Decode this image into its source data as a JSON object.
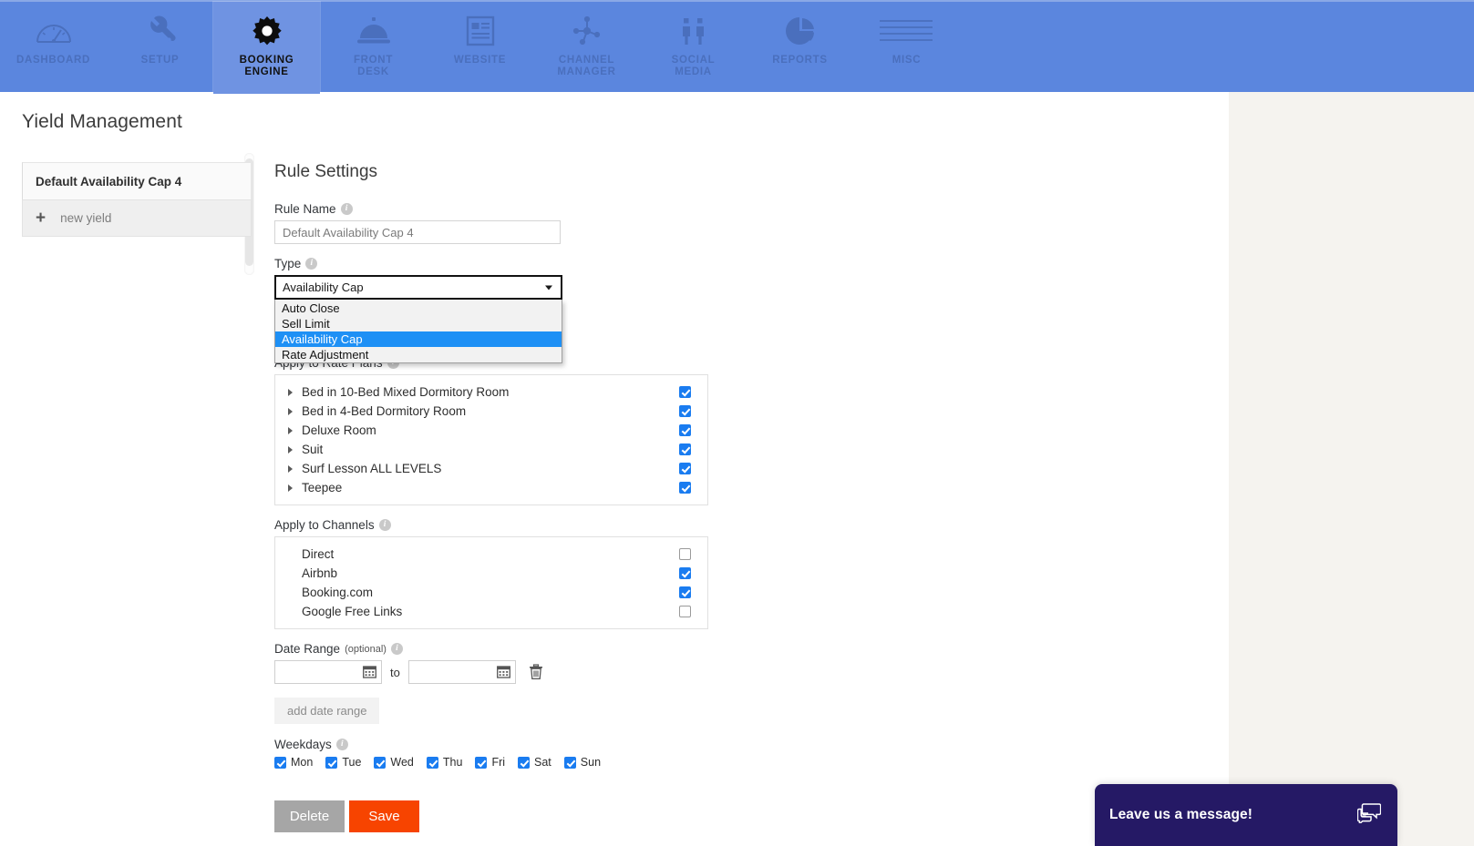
{
  "topnav": {
    "items": [
      {
        "label": "DASHBOARD",
        "icon": "gauge-icon",
        "active": false
      },
      {
        "label": "SETUP",
        "icon": "wrench-icon",
        "active": false
      },
      {
        "label": "BOOKING\nENGINE",
        "line1": "BOOKING",
        "line2": "ENGINE",
        "icon": "gear-icon",
        "active": true
      },
      {
        "label": "FRONT DESK",
        "line1": "FRONT",
        "line2": "DESK",
        "icon": "bell-icon",
        "active": false
      },
      {
        "label": "WEBSITE",
        "line1": "WEBSITE",
        "line2": "",
        "icon": "webpage-icon",
        "active": false
      },
      {
        "label": "CHANNEL MANAGER",
        "line1": "CHANNEL",
        "line2": "MANAGER",
        "icon": "network-icon",
        "active": false
      },
      {
        "label": "SOCIAL MEDIA",
        "line1": "SOCIAL",
        "line2": "MEDIA",
        "icon": "people-icon",
        "active": false
      },
      {
        "label": "REPORTS",
        "line1": "REPORTS",
        "line2": "",
        "icon": "pie-chart-icon",
        "active": false
      },
      {
        "label": "MISC",
        "line1": "MISC",
        "line2": "",
        "icon": "lines-icon",
        "active": false
      }
    ],
    "background_color": "#5b86de"
  },
  "page": {
    "title": "Yield Management"
  },
  "rule_list": {
    "items": [
      {
        "label": "Default Availability Cap 4",
        "selected": true
      }
    ],
    "new_item_label": "new yield"
  },
  "form": {
    "section_title": "Rule Settings",
    "rule_name": {
      "label": "Rule Name",
      "value": "Default Availability Cap 4"
    },
    "type": {
      "label": "Type",
      "selected": "Availability Cap",
      "options": [
        {
          "label": "Auto Close",
          "selected": false
        },
        {
          "label": "Sell Limit",
          "selected": false
        },
        {
          "label": "Availability Cap",
          "selected": true
        },
        {
          "label": "Rate Adjustment",
          "selected": false
        }
      ]
    },
    "rate_plans": {
      "label": "Apply to Rate Plans",
      "items": [
        {
          "label": "Bed in 10-Bed Mixed Dormitory Room",
          "checked": true
        },
        {
          "label": "Bed in 4-Bed Dormitory Room",
          "checked": true
        },
        {
          "label": "Deluxe Room",
          "checked": true
        },
        {
          "label": "Suit",
          "checked": true
        },
        {
          "label": "Surf Lesson ALL LEVELS",
          "checked": true
        },
        {
          "label": "Teepee",
          "checked": true
        }
      ]
    },
    "channels": {
      "label": "Apply to Channels",
      "items": [
        {
          "label": "Direct",
          "checked": false
        },
        {
          "label": "Airbnb",
          "checked": true
        },
        {
          "label": "Booking.com",
          "checked": true
        },
        {
          "label": "Google Free Links",
          "checked": false
        }
      ]
    },
    "date_range": {
      "label": "Date Range",
      "optional_note": "(optional)",
      "from_value": "",
      "to_value": "",
      "separator": "to",
      "add_button": "add date range"
    },
    "weekdays": {
      "label": "Weekdays",
      "items": [
        {
          "label": "Mon",
          "checked": true
        },
        {
          "label": "Tue",
          "checked": true
        },
        {
          "label": "Wed",
          "checked": true
        },
        {
          "label": "Thu",
          "checked": true
        },
        {
          "label": "Fri",
          "checked": true
        },
        {
          "label": "Sat",
          "checked": true
        },
        {
          "label": "Sun",
          "checked": true
        }
      ]
    },
    "actions": {
      "delete_label": "Delete",
      "save_label": "Save",
      "delete_color": "#a6a6a6",
      "save_color": "#f74400"
    }
  },
  "chat": {
    "message": "Leave us a message!",
    "background_color": "#251965"
  }
}
